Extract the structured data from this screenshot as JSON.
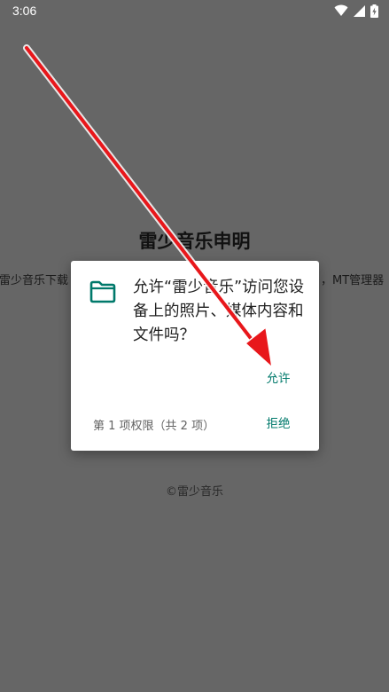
{
  "status_bar": {
    "time": "3:06"
  },
  "background_page": {
    "title": "雷少音乐申明",
    "body_left": "雷少音乐下载",
    "body_right": "，MT管理器",
    "footer": "©雷少音乐"
  },
  "permission_dialog": {
    "message": "允许“雷少音乐”访问您设备上的照片、媒体内容和文件吗？",
    "allow_label": "允许",
    "permission_count": "第 1 项权限（共 2 项）",
    "deny_label": "拒绝"
  },
  "colors": {
    "scrim": "#666666",
    "accent": "#00796b",
    "annotation_arrow": "#e8171b"
  },
  "icons": {
    "status": [
      "wifi-icon",
      "signal-icon",
      "battery-charging-icon"
    ],
    "dialog": "folder-icon"
  }
}
